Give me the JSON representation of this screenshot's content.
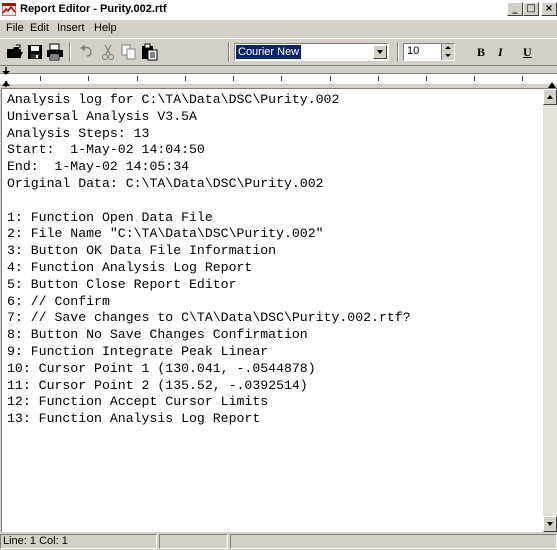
{
  "window": {
    "title": "Report Editor - Purity.002.rtf"
  },
  "titlebar_buttons": {
    "minimize": "_",
    "maximize": "□",
    "close": "×"
  },
  "menu": [
    "File",
    "Edit",
    "Insert",
    "Help"
  ],
  "toolbar": {
    "icons": [
      "open-icon",
      "save-icon",
      "print-icon",
      "undo-icon",
      "cut-icon",
      "copy-icon",
      "paste-icon"
    ],
    "font_name": "Courier New",
    "font_size": "10",
    "bold": "B",
    "italic": "I",
    "underline": "U"
  },
  "document": {
    "lines": [
      "Analysis log for C:\\TA\\Data\\DSC\\Purity.002",
      "Universal Analysis V3.5A",
      "Analysis Steps: 13",
      "Start:  1-May-02 14:04:50",
      "End:  1-May-02 14:05:34",
      "Original Data: C:\\TA\\Data\\DSC\\Purity.002",
      "",
      "1: Function Open Data File",
      "2: File Name \"C:\\TA\\Data\\DSC\\Purity.002\"",
      "3: Button OK Data File Information",
      "4: Function Analysis Log Report",
      "5: Button Close Report Editor",
      "6: // Confirm",
      "7: // Save changes to C\\TA\\Data\\DSC\\Purity.002.rtf?",
      "8: Button No Save Changes Confirmation",
      "9: Function Integrate Peak Linear",
      "10: Cursor Point 1 (130.041, -.0544878)",
      "11: Cursor Point 2 (135.52, -.0392514)",
      "12: Function Accept Cursor Limits",
      "13: Function Analysis Log Report"
    ]
  },
  "status": {
    "position": "Line:  1  Col:  1",
    "pane2": "",
    "pane3": ""
  },
  "colors": {
    "face": "#d4d0c8",
    "selection": "#0a246a",
    "icon_red": "#cc2200"
  }
}
